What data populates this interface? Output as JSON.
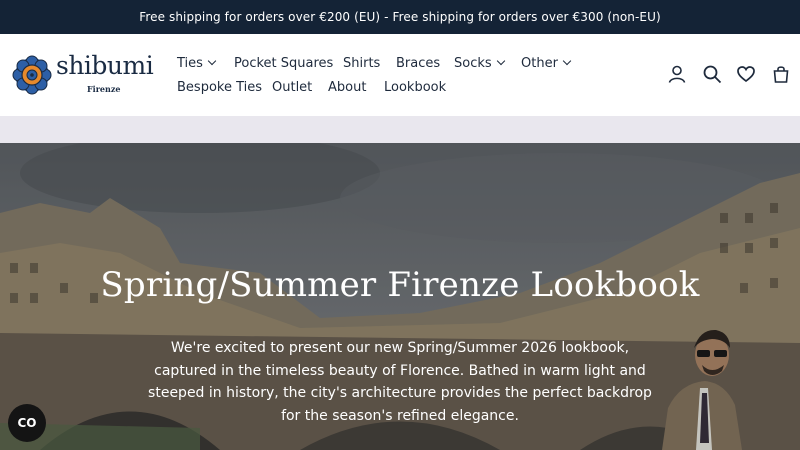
{
  "announcement": "Free shipping for orders over €200 (EU) - Free shipping for orders over €300 (non-EU)",
  "brand": {
    "name": "shibumi",
    "subtitle": "Firenze"
  },
  "nav": {
    "ties": "Ties",
    "pocket_squares": "Pocket Squares",
    "shirts": "Shirts",
    "braces": "Braces",
    "socks": "Socks",
    "other": "Other",
    "bespoke_ties": "Bespoke Ties",
    "outlet": "Outlet",
    "about": "About",
    "lookbook": "Lookbook"
  },
  "icons": [
    "account-icon",
    "search-icon",
    "heart-icon",
    "cart-icon"
  ],
  "hero": {
    "title": "Spring/Summer Firenze Lookbook",
    "text": "We're excited to present our new Spring/Summer 2026 lookbook, captured in the timeless beauty of Florence. Bathed in warm light and steeped in history, the city's architecture provides the perfect backdrop for the season's refined elegance."
  },
  "accessibility_button": "CO",
  "colors": {
    "announcement_bg": "#142336",
    "brand": "#1a2b43",
    "logo_blue": "#2d5fa6",
    "logo_orange": "#e6892c"
  }
}
